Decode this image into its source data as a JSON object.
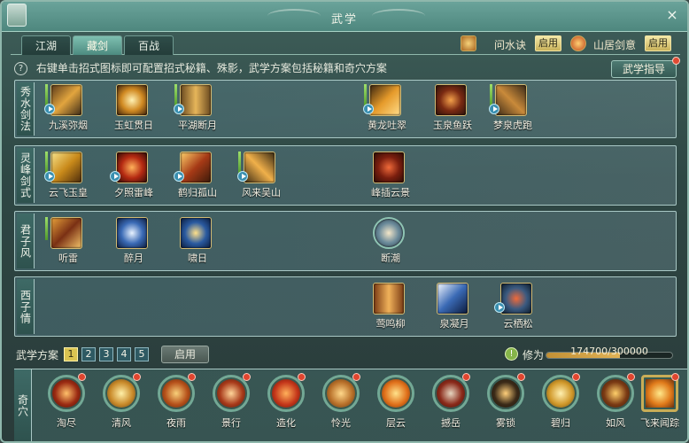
{
  "window": {
    "title": "武学",
    "close": "×"
  },
  "tabs": [
    {
      "label": "江湖",
      "active": false
    },
    {
      "label": "藏剑",
      "active": true
    },
    {
      "label": "百战",
      "active": false
    }
  ],
  "toolbar": {
    "item1_label": "问水诀",
    "item1_btn": "启用",
    "item2_label": "山居剑意",
    "item2_btn": "启用"
  },
  "hint": "右键单击招式图标即可配置招式秘籍、殊影，武学方案包括秘籍和奇穴方案",
  "guide_button": "武学指导",
  "panels": [
    {
      "label": "秀水剑法",
      "skills": [
        "九溪弥烟",
        "玉虹贯日",
        "平湖断月",
        "黄龙吐翠",
        "玉泉鱼跃",
        "梦泉虎跑"
      ]
    },
    {
      "label": "灵峰剑式",
      "skills": [
        "云飞玉皇",
        "夕照雷峰",
        "鹤归孤山",
        "风来吴山",
        "峰插云景"
      ]
    },
    {
      "label": "君子风",
      "skills": [
        "听雷",
        "醉月",
        "啸日",
        "断潮"
      ]
    },
    {
      "label": "西子情",
      "skills": [
        "莺鸣柳",
        "泉凝月",
        "云栖松"
      ]
    }
  ],
  "scheme": {
    "label": "武学方案",
    "numbers": [
      "1",
      "2",
      "3",
      "4",
      "5"
    ],
    "active_index": 0,
    "enable": "启用"
  },
  "xiuwei": {
    "label": "修为",
    "text": "174700/300000",
    "fraction": 0.5823
  },
  "qixue": {
    "label": "奇穴",
    "items": [
      "淘尽",
      "清风",
      "夜雨",
      "景行",
      "造化",
      "怜光",
      "层云",
      "撼岳",
      "雾锁",
      "碧归",
      "如风",
      "飞来闻踪"
    ]
  },
  "colors": {
    "accent": "#d9c351",
    "panel_border": "#a9c8c5",
    "notify": "#e0452f"
  }
}
